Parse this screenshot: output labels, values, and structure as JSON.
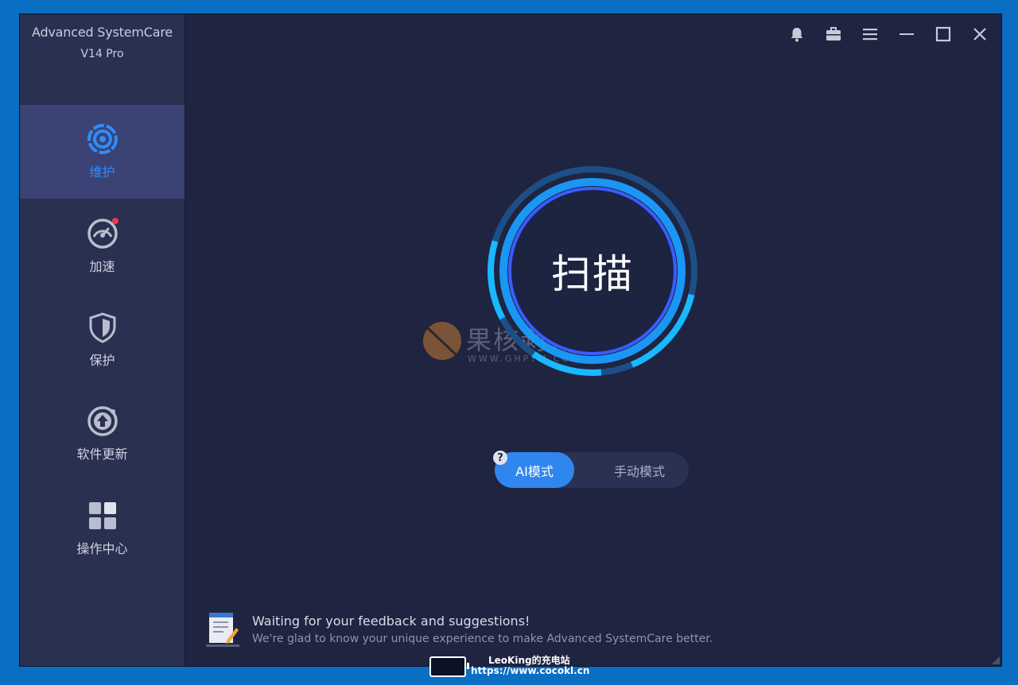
{
  "app": {
    "title": "Advanced SystemCare",
    "version": "V14 Pro"
  },
  "sidebar": {
    "items": [
      {
        "label": "维护",
        "icon": "maintenance-icon",
        "active": true
      },
      {
        "label": "加速",
        "icon": "speedometer-icon",
        "active": false,
        "badge": true
      },
      {
        "label": "保护",
        "icon": "shield-icon",
        "active": false
      },
      {
        "label": "软件更新",
        "icon": "update-icon",
        "active": false
      },
      {
        "label": "操作中心",
        "icon": "grid-icon",
        "active": false
      }
    ]
  },
  "topbar": {
    "icons": [
      "bell-icon",
      "toolbox-icon",
      "menu-icon",
      "minimize-icon",
      "maximize-icon",
      "close-icon"
    ]
  },
  "scan": {
    "label": "扫描"
  },
  "mode": {
    "ai_label": "AI模式",
    "manual_label": "手动模式",
    "help_glyph": "?",
    "selected": "AI模式"
  },
  "feedback": {
    "title": "Waiting for your feedback and suggestions!",
    "subtitle": "We're glad to know your unique experience to make Advanced SystemCare better."
  },
  "watermark": {
    "text": "果核剥壳",
    "url": "WWW.GHPYM.COM"
  },
  "overlay": {
    "name": "LeoKing的充电站",
    "url": "https://www.cocokl.cn"
  },
  "colors": {
    "accent": "#2f86ee",
    "ring": "#19b8ff",
    "window_bg": "#1f2440",
    "sidebar_bg": "#2a3050",
    "active_bg": "#3a4373"
  }
}
